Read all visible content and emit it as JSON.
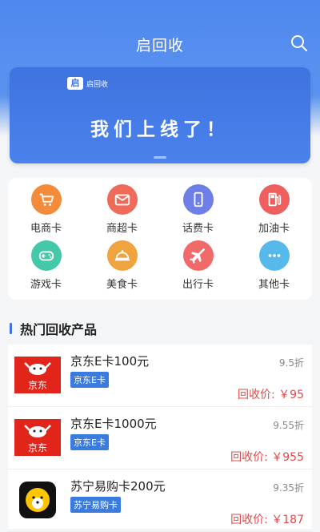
{
  "header": {
    "title": "启回收"
  },
  "banner": {
    "logo_text": "启回收",
    "logo_mark": "启",
    "headline": "我们上线了！"
  },
  "categories": [
    {
      "label": "电商卡",
      "icon": "cart-icon",
      "color": "#f38b3a"
    },
    {
      "label": "商超卡",
      "icon": "envelope-icon",
      "color": "#ee6b5a"
    },
    {
      "label": "话费卡",
      "icon": "phone-icon",
      "color": "#6f7fe8"
    },
    {
      "label": "加油卡",
      "icon": "fuel-icon",
      "color": "#ef5f5f"
    },
    {
      "label": "游戏卡",
      "icon": "gamepad-icon",
      "color": "#44c9a8"
    },
    {
      "label": "美食卡",
      "icon": "dish-icon",
      "color": "#f0a440"
    },
    {
      "label": "出行卡",
      "icon": "plane-icon",
      "color": "#f06a6a"
    },
    {
      "label": "其他卡",
      "icon": "more-icon",
      "color": "#55b9ec"
    }
  ],
  "section": {
    "title": "热门回收产品"
  },
  "products": [
    {
      "name": "京东E卡100元",
      "tag": "京东E卡",
      "discount": "9.5折",
      "price": "回收价: ￥95",
      "brand": "京东",
      "brand_color": "#e1251b"
    },
    {
      "name": "京东E卡1000元",
      "tag": "京东E卡",
      "discount": "9.55折",
      "price": "回收价: ￥955",
      "brand": "京东",
      "brand_color": "#e1251b"
    },
    {
      "name": "苏宁易购卡200元",
      "tag": "苏宁易购卡",
      "discount": "9.35折",
      "price": "回收价: ￥187",
      "brand_color": "#ffc600"
    }
  ]
}
